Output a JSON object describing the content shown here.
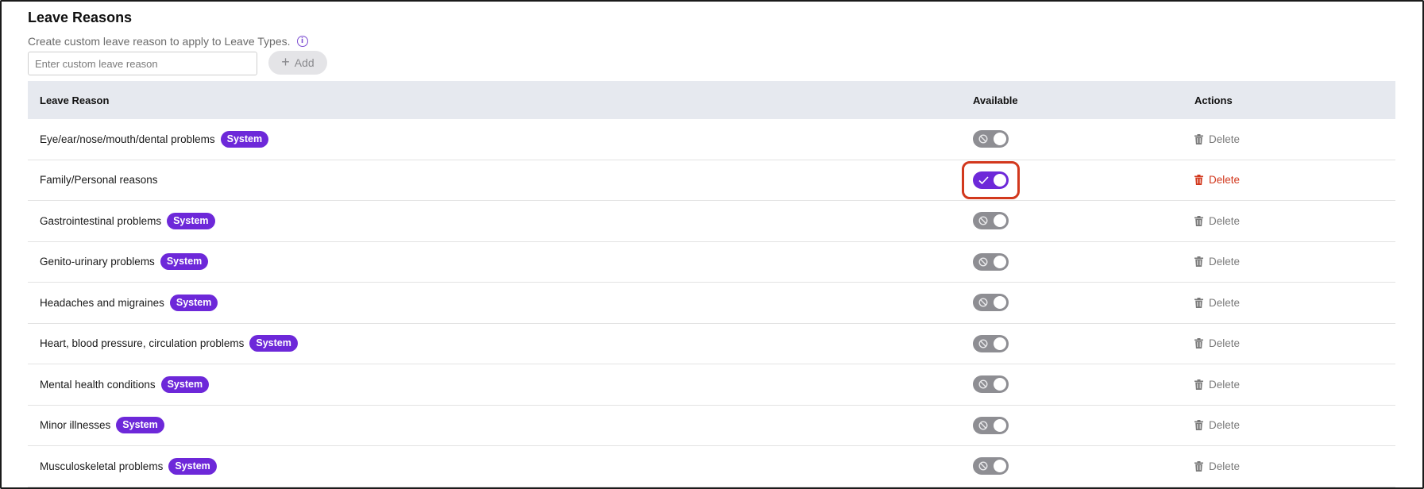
{
  "section": {
    "title": "Leave Reasons",
    "subtitle": "Create custom leave reason to apply to Leave Types.",
    "info_icon": "info-icon"
  },
  "add_form": {
    "input_placeholder": "Enter custom leave reason",
    "input_value": "",
    "add_label": "Add"
  },
  "table": {
    "headers": {
      "reason": "Leave Reason",
      "available": "Available",
      "actions": "Actions"
    },
    "rows": [
      {
        "reason": "Eye/ear/nose/mouth/dental problems",
        "badge": "System",
        "available": false,
        "action": "Delete"
      },
      {
        "reason": "Family/Personal reasons",
        "badge": "",
        "available": true,
        "action": "Delete"
      },
      {
        "reason": "Gastrointestinal problems",
        "badge": "System",
        "available": false,
        "action": "Delete"
      },
      {
        "reason": "Genito-urinary problems",
        "badge": "System",
        "available": false,
        "action": "Delete"
      },
      {
        "reason": "Headaches and migraines",
        "badge": "System",
        "available": false,
        "action": "Delete"
      },
      {
        "reason": "Heart, blood pressure, circulation problems",
        "badge": "System",
        "available": false,
        "action": "Delete"
      },
      {
        "reason": "Mental health conditions",
        "badge": "System",
        "available": false,
        "action": "Delete"
      },
      {
        "reason": "Minor illnesses",
        "badge": "System",
        "available": false,
        "action": "Delete"
      },
      {
        "reason": "Musculoskeletal problems",
        "badge": "System",
        "available": false,
        "action": "Delete"
      }
    ]
  },
  "colors": {
    "accent": "#6d28d9",
    "toggle_off": "#8e8e93",
    "delete_active": "#d2381d",
    "header_bg": "#e6e9ef"
  }
}
